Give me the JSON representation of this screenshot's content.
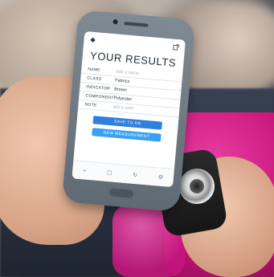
{
  "app": {
    "title": "YOUR RESULTS",
    "subtitle": "",
    "icons": {
      "left": "logo-icon",
      "right": "export-icon"
    }
  },
  "fields": [
    {
      "label": "NAME",
      "value": "add a name",
      "placeholder": true
    },
    {
      "label": "CLASS",
      "value": "Fabrics",
      "placeholder": false
    },
    {
      "label": "INDICATOR",
      "value": "Brown",
      "placeholder": false
    },
    {
      "label": "COMPONENT",
      "value": "Polyester",
      "placeholder": false
    },
    {
      "label": "NOTE",
      "value": "add a note",
      "placeholder": true
    }
  ],
  "buttons": {
    "primary": "SAVE TO DB",
    "secondary": "NEW MEASUREMENT"
  },
  "nav": [
    {
      "label": "",
      "icon": "chart-icon"
    },
    {
      "label": "",
      "icon": "database-icon"
    },
    {
      "label": "",
      "icon": "refresh-icon"
    },
    {
      "label": "",
      "icon": "settings-icon"
    }
  ]
}
